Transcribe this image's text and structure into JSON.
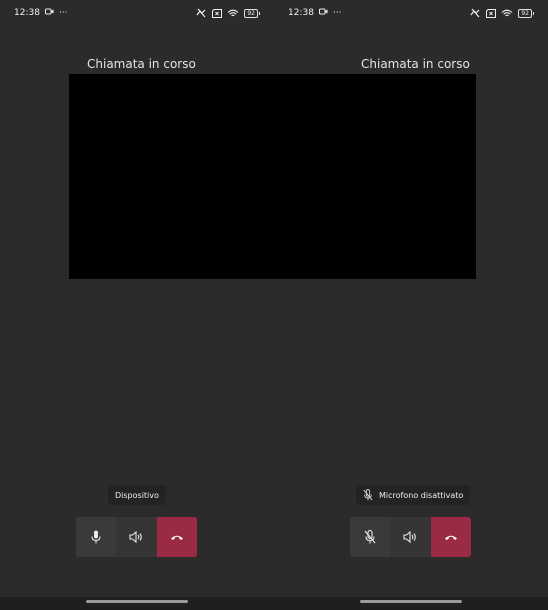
{
  "screens": [
    {
      "status": {
        "time": "12:38",
        "dots": "···",
        "battery": "92",
        "left_icons": [
          "camera-status-icon"
        ],
        "right_icons": [
          "data-saver-icon",
          "sim-x-icon",
          "wifi-icon",
          "battery-icon"
        ]
      },
      "call_title": "Chiamata in corso",
      "tooltip": {
        "text": "Dispositivo",
        "icon": ""
      },
      "controls": [
        {
          "name": "microphone-button",
          "icon": "microphone-icon"
        },
        {
          "name": "speaker-button",
          "icon": "speaker-icon"
        },
        {
          "name": "end-call-button",
          "icon": "phone-hangup-icon",
          "color": "#9b2a45"
        }
      ]
    },
    {
      "status": {
        "time": "12:38",
        "dots": "···",
        "battery": "92",
        "left_icons": [
          "camera-status-icon"
        ],
        "right_icons": [
          "data-saver-icon",
          "sim-x-icon",
          "wifi-icon",
          "battery-icon"
        ]
      },
      "call_title": "Chiamata in corso",
      "tooltip": {
        "text": "Microfono disattivato",
        "icon": "microphone-muted-icon"
      },
      "controls": [
        {
          "name": "microphone-muted-button",
          "icon": "microphone-muted-icon"
        },
        {
          "name": "speaker-button",
          "icon": "speaker-icon"
        },
        {
          "name": "end-call-button",
          "icon": "phone-hangup-icon",
          "color": "#9b2a45"
        }
      ]
    }
  ],
  "colors": {
    "background": "#2b2b2b",
    "video": "#000000",
    "end_call": "#9b2a45",
    "control": "#3a3a3a"
  }
}
